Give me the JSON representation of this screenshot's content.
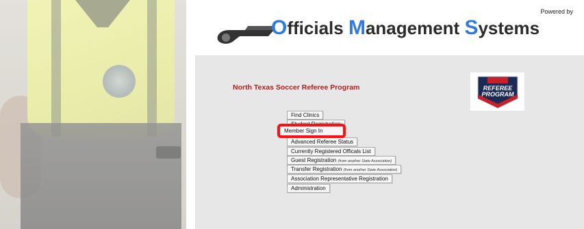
{
  "header": {
    "powered_by": "Powered by",
    "title_parts": [
      {
        "text": "O",
        "cap": true
      },
      {
        "text": "fficials ",
        "cap": false
      },
      {
        "text": "M",
        "cap": true
      },
      {
        "text": "anagement ",
        "cap": false
      },
      {
        "text": "S",
        "cap": true
      },
      {
        "text": "ystems",
        "cap": false
      }
    ]
  },
  "program": {
    "title": "North Texas Soccer Referee Program",
    "logo_text_top": "REFEREE",
    "logo_text_bottom": "PROGRAM"
  },
  "menu": {
    "items": [
      {
        "label": "Find Clinics",
        "note": ""
      },
      {
        "label": "Student Registration",
        "note": ""
      },
      {
        "label": "Member Sign In",
        "note": ""
      },
      {
        "label": "Advanced Referee Status",
        "note": ""
      },
      {
        "label": "Currently Registered Officals List",
        "note": ""
      },
      {
        "label": "Guest Registration",
        "note": "(from another State Association)"
      },
      {
        "label": "Transfer Registration",
        "note": "(from another State Association)"
      },
      {
        "label": "Association Representative Registration",
        "note": ""
      },
      {
        "label": "Administration",
        "note": ""
      }
    ]
  },
  "colors": {
    "accent_blue": "#2f7be0",
    "program_red": "#b01c1c",
    "highlight_red": "#ff1010"
  }
}
